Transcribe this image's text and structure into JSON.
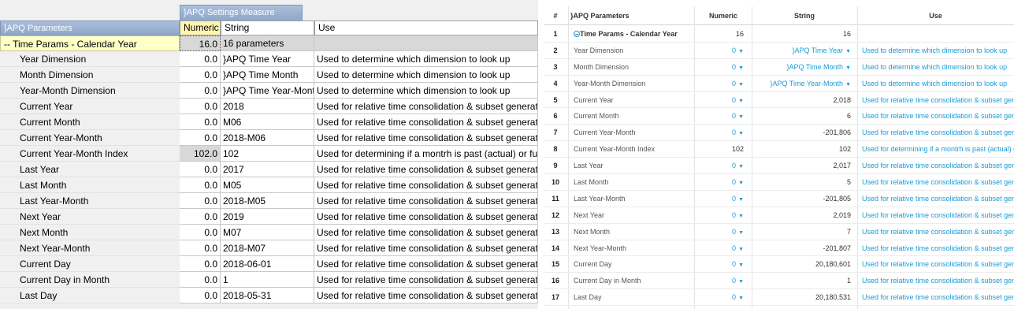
{
  "left_panel": {
    "measure_dimension_tab": "}APQ Settings Measure",
    "row_dimension_header": "}APQ Parameters",
    "columns": [
      "Numeric",
      "String",
      "Use"
    ],
    "rows": [
      {
        "name": "-- Time Params - Calendar Year",
        "numeric": "16.0",
        "string": "16 parameters",
        "use": "",
        "type": "consol"
      },
      {
        "name": "Year Dimension",
        "numeric": "0.0",
        "string": "}APQ Time Year",
        "use": "Used to determine which dimension to look up",
        "type": "leaf"
      },
      {
        "name": "Month Dimension",
        "numeric": "0.0",
        "string": "}APQ Time Month",
        "use": "Used to determine which dimension to look up",
        "type": "leaf"
      },
      {
        "name": "Year-Month Dimension",
        "numeric": "0.0",
        "string": "}APQ Time Year-Month",
        "use": "Used to determine which dimension to look up",
        "type": "leaf"
      },
      {
        "name": "Current Year",
        "numeric": "0.0",
        "string": "2018",
        "use": "Used for relative time consolidation & subset generation",
        "type": "leaf"
      },
      {
        "name": "Current Month",
        "numeric": "0.0",
        "string": "M06",
        "use": "Used for relative time consolidation & subset generation",
        "type": "leaf"
      },
      {
        "name": "Current Year-Month",
        "numeric": "0.0",
        "string": "2018-M06",
        "use": "Used for relative time consolidation & subset generation",
        "type": "leaf"
      },
      {
        "name": "Current Year-Month Index",
        "numeric": "102.0",
        "string": "102",
        "use": "Used for determining if a montrh is past (actual) or future",
        "type": "calc"
      },
      {
        "name": "Last Year",
        "numeric": "0.0",
        "string": "2017",
        "use": "Used for relative time consolidation & subset generation",
        "type": "leaf"
      },
      {
        "name": "Last Month",
        "numeric": "0.0",
        "string": "M05",
        "use": "Used for relative time consolidation & subset generation",
        "type": "leaf"
      },
      {
        "name": "Last Year-Month",
        "numeric": "0.0",
        "string": "2018-M05",
        "use": "Used for relative time consolidation & subset generation",
        "type": "leaf"
      },
      {
        "name": "Next Year",
        "numeric": "0.0",
        "string": "2019",
        "use": "Used for relative time consolidation & subset generation",
        "type": "leaf"
      },
      {
        "name": "Next Month",
        "numeric": "0.0",
        "string": "M07",
        "use": "Used for relative time consolidation & subset generation",
        "type": "leaf"
      },
      {
        "name": "Next Year-Month",
        "numeric": "0.0",
        "string": "2018-M07",
        "use": "Used for relative time consolidation & subset generation",
        "type": "leaf"
      },
      {
        "name": "Current Day",
        "numeric": "0.0",
        "string": "2018-06-01",
        "use": "Used for relative time consolidation & subset generation",
        "type": "leaf"
      },
      {
        "name": "Current Day in Month",
        "numeric": "0.0",
        "string": "1",
        "use": "Used for relative time consolidation & subset generation",
        "type": "leaf"
      },
      {
        "name": "Last Day",
        "numeric": "0.0",
        "string": "2018-05-31",
        "use": "Used for relative time consolidation & subset generation",
        "type": "leaf"
      }
    ]
  },
  "right_panel": {
    "columns": [
      "#",
      "}APQ Parameters",
      "Numeric",
      "String",
      "Use"
    ],
    "rows": [
      {
        "idx": "1",
        "name": "Time Params - Calendar Year",
        "numeric": "16",
        "numeric_pick": false,
        "string": "16",
        "string_pick": false,
        "use": "",
        "type": "consol"
      },
      {
        "idx": "2",
        "name": "Year Dimension",
        "numeric": "0",
        "numeric_pick": true,
        "string": "}APQ Time Year",
        "string_pick": true,
        "use": "Used to determine which dimension to look up",
        "type": "leaf"
      },
      {
        "idx": "3",
        "name": "Month Dimension",
        "numeric": "0",
        "numeric_pick": true,
        "string": "}APQ Time Month",
        "string_pick": true,
        "use": "Used to determine which dimension to look up",
        "type": "leaf"
      },
      {
        "idx": "4",
        "name": "Year-Month Dimension",
        "numeric": "0",
        "numeric_pick": true,
        "string": "}APQ Time Year-Month",
        "string_pick": true,
        "use": "Used to determine which dimension to look up",
        "type": "leaf"
      },
      {
        "idx": "5",
        "name": "Current Year",
        "numeric": "0",
        "numeric_pick": true,
        "string": "2,018",
        "string_pick": false,
        "use": "Used for relative time consolidation & subset gen",
        "type": "leaf"
      },
      {
        "idx": "6",
        "name": "Current Month",
        "numeric": "0",
        "numeric_pick": true,
        "string": "6",
        "string_pick": false,
        "use": "Used for relative time consolidation & subset gen",
        "type": "leaf"
      },
      {
        "idx": "7",
        "name": "Current Year-Month",
        "numeric": "0",
        "numeric_pick": true,
        "string": "-201,806",
        "string_pick": false,
        "use": "Used for relative time consolidation & subset gen",
        "type": "leaf"
      },
      {
        "idx": "8",
        "name": "Current Year-Month Index",
        "numeric": "102",
        "numeric_pick": false,
        "string": "102",
        "string_pick": false,
        "use": "Used for determining if a montrh is past (actual) o",
        "type": "calc"
      },
      {
        "idx": "9",
        "name": "Last Year",
        "numeric": "0",
        "numeric_pick": true,
        "string": "2,017",
        "string_pick": false,
        "use": "Used for relative time consolidation & subset gen",
        "type": "leaf"
      },
      {
        "idx": "10",
        "name": "Last Month",
        "numeric": "0",
        "numeric_pick": true,
        "string": "5",
        "string_pick": false,
        "use": "Used for relative time consolidation & subset gen",
        "type": "leaf"
      },
      {
        "idx": "11",
        "name": "Last Year-Month",
        "numeric": "0",
        "numeric_pick": true,
        "string": "-201,805",
        "string_pick": false,
        "use": "Used for relative time consolidation & subset gen",
        "type": "leaf"
      },
      {
        "idx": "12",
        "name": "Next Year",
        "numeric": "0",
        "numeric_pick": true,
        "string": "2,019",
        "string_pick": false,
        "use": "Used for relative time consolidation & subset gen",
        "type": "leaf"
      },
      {
        "idx": "13",
        "name": "Next Month",
        "numeric": "0",
        "numeric_pick": true,
        "string": "7",
        "string_pick": false,
        "use": "Used for relative time consolidation & subset gen",
        "type": "leaf"
      },
      {
        "idx": "14",
        "name": "Next Year-Month",
        "numeric": "0",
        "numeric_pick": true,
        "string": "-201,807",
        "string_pick": false,
        "use": "Used for relative time consolidation & subset gen",
        "type": "leaf"
      },
      {
        "idx": "15",
        "name": "Current Day",
        "numeric": "0",
        "numeric_pick": true,
        "string": "20,180,601",
        "string_pick": false,
        "use": "Used for relative time consolidation & subset gen",
        "type": "leaf"
      },
      {
        "idx": "16",
        "name": "Current Day in Month",
        "numeric": "0",
        "numeric_pick": true,
        "string": "1",
        "string_pick": false,
        "use": "Used for relative time consolidation & subset gen",
        "type": "leaf"
      },
      {
        "idx": "17",
        "name": "Last Day",
        "numeric": "0",
        "numeric_pick": true,
        "string": "20,180,531",
        "string_pick": false,
        "use": "Used for relative time consolidation & subset gen",
        "type": "leaf"
      }
    ]
  },
  "colors": {
    "header_blue": "#8ea7c9",
    "consol_yellow": "#ffffc8",
    "link_blue": "#1b9ad6"
  }
}
